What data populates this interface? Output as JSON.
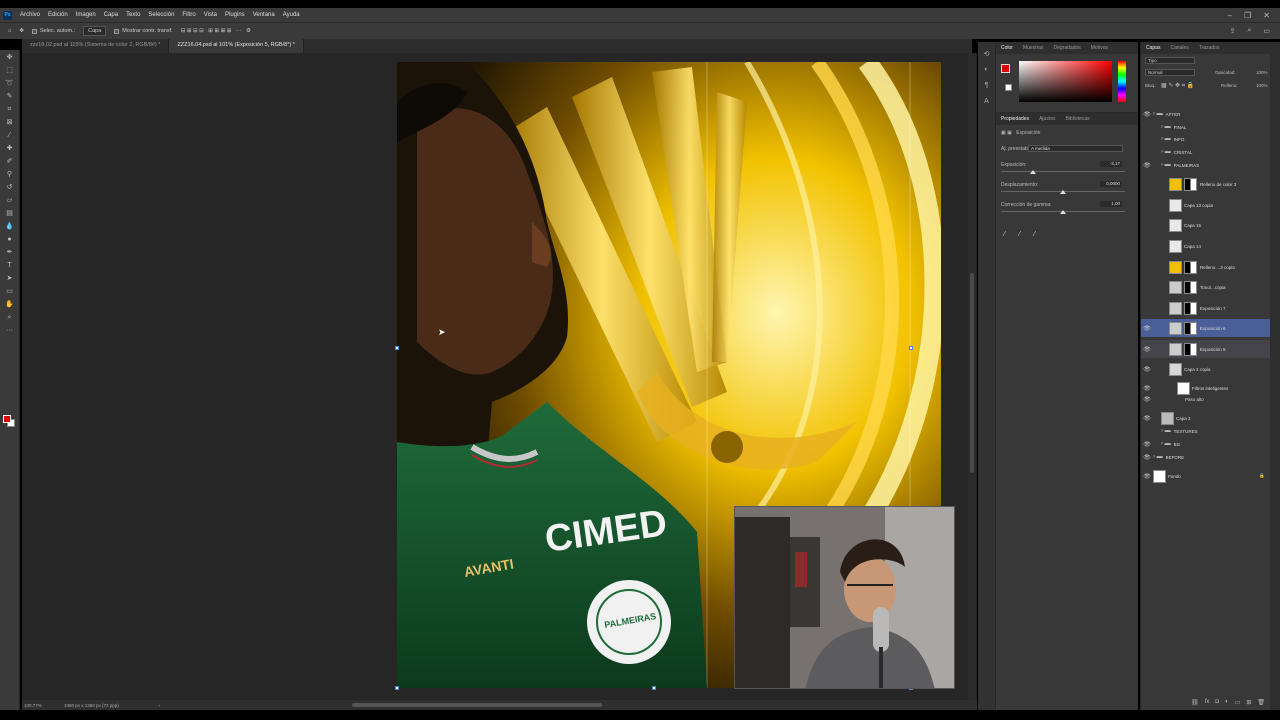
{
  "app": {
    "logo": "Ps"
  },
  "menu": [
    "Archivo",
    "Edición",
    "Imagen",
    "Capa",
    "Texto",
    "Selección",
    "Filtro",
    "Vista",
    "Plugins",
    "Ventana",
    "Ayuda"
  ],
  "window_controls": [
    "–",
    "❐",
    "✕"
  ],
  "options": {
    "auto_select": "Selec. autom.:",
    "auto_select_value": "Capa",
    "show_transform": "Mostrar contr. transf."
  },
  "tabs": [
    {
      "label": "zzz19.02.psd al 115% (Sistema de color 2, RGB/8#) *",
      "active": false
    },
    {
      "label": "ZZZ16.04.psd al 101% (Exposición 5, RGB/8*) *",
      "active": true
    }
  ],
  "statusbar": {
    "zoom": "100,77%",
    "doc_info": "1080 px x 1350 px (72 ppp)"
  },
  "color_panel": {
    "tabs": [
      "Color",
      "Muestras",
      "Degradados",
      "Motivos"
    ],
    "fg_color": "#e00000",
    "bg_color": "#ffffff"
  },
  "properties_panel": {
    "tabs": [
      "Propiedades",
      "Ajustes",
      "Bibliotecas"
    ],
    "title": "Exposición",
    "preset_label": "Aj. preestabl.",
    "preset_value": "A medida",
    "exposure_label": "Exposición:",
    "exposure_value": "-3,17",
    "offset_label": "Desplazamiento:",
    "offset_value": "0,0000",
    "gamma_label": "Corrección de gamma:",
    "gamma_value": "1,00"
  },
  "layers_panel": {
    "tabs": [
      "Capas",
      "Canales",
      "Trazados"
    ],
    "filter_label": "Tipo",
    "blend_mode": "Normal",
    "opacity_label": "Opacidad:",
    "opacity_value": "100%",
    "lock_label": "Bloq.:",
    "fill_label": "Relleno:",
    "fill_value": "100%",
    "layers": [
      {
        "name": "AFTER",
        "kind": "group",
        "indent": 0,
        "visible": true
      },
      {
        "name": "FINAL",
        "kind": "group",
        "indent": 1,
        "visible": false
      },
      {
        "name": "INFO",
        "kind": "group",
        "indent": 1,
        "visible": false
      },
      {
        "name": "CRISTAL",
        "kind": "group",
        "indent": 1,
        "visible": false
      },
      {
        "name": "PALMEIRAS",
        "kind": "group",
        "indent": 1,
        "visible": true
      },
      {
        "name": "Relleno de color 3",
        "kind": "fill",
        "thumb": "#f2c000",
        "indent": 2,
        "visible": false
      },
      {
        "name": "Capa 13 copia",
        "kind": "pixel",
        "thumb": "#e8e8e8",
        "indent": 2,
        "visible": false
      },
      {
        "name": "Capa 15",
        "kind": "pixel",
        "thumb": "#e8e8e8",
        "indent": 2,
        "visible": false
      },
      {
        "name": "Capa 14",
        "kind": "pixel",
        "thumb": "#e8e8e8",
        "indent": 2,
        "visible": false
      },
      {
        "name": "Relleno ...3 copia",
        "kind": "fill",
        "thumb": "#f2c000",
        "indent": 2,
        "visible": false
      },
      {
        "name": "Tono/...copia",
        "kind": "adjust",
        "thumb": "#cccccc",
        "indent": 2,
        "visible": false
      },
      {
        "name": "Exposición 7",
        "kind": "adjust",
        "thumb": "#cccccc",
        "indent": 2,
        "visible": false
      },
      {
        "name": "Exposición 6",
        "kind": "adjust",
        "thumb": "#cccccc",
        "indent": 2,
        "visible": true,
        "selected": true
      },
      {
        "name": "Exposición 5",
        "kind": "adjust",
        "thumb": "#cccccc",
        "indent": 2,
        "visible": true,
        "selected2": true
      },
      {
        "name": "Capa 3 copia",
        "kind": "smart",
        "thumb": "#d7d7d7",
        "indent": 2,
        "visible": true
      },
      {
        "name": "Filtros inteligentes",
        "kind": "sub",
        "thumb": "#ffffff",
        "indent": 3,
        "visible": true
      },
      {
        "name": "Paso alto",
        "kind": "sub2",
        "indent": 4,
        "visible": true
      },
      {
        "name": "Capa 3",
        "kind": "pixel",
        "thumb": "#bbbbbb",
        "indent": 1,
        "visible": true
      },
      {
        "name": "TEXTURES",
        "kind": "group",
        "indent": 1,
        "visible": false
      },
      {
        "name": "BG",
        "kind": "group",
        "indent": 1,
        "visible": true
      },
      {
        "name": "BEFORE",
        "kind": "group",
        "indent": 0,
        "visible": true
      },
      {
        "name": "Fondo",
        "kind": "bg",
        "thumb": "#ffffff",
        "indent": 0,
        "visible": true
      }
    ]
  },
  "canvas": {
    "jersey_sponsor": "CIMED",
    "jersey_brand": "AVANTI",
    "crest_text": "PALMEIRAS"
  }
}
